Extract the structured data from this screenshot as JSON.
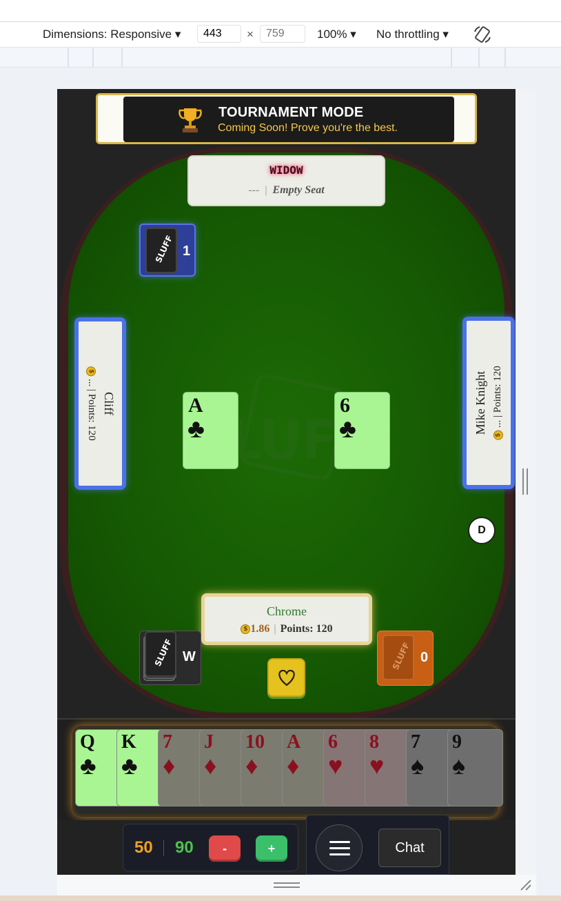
{
  "devtools": {
    "dimensions_label": "Dimensions: Responsive",
    "width": "443",
    "times": "×",
    "height_placeholder": "759",
    "zoom": "100%",
    "throttling": "No throttling"
  },
  "banner": {
    "title": "TOURNAMENT MODE",
    "subtitle": "Coming Soon! Prove you're the best."
  },
  "watermark": "LUF",
  "widow": {
    "name": "WIDOW",
    "dash": "---",
    "sep": "|",
    "status": "Empty Seat"
  },
  "players": {
    "left": {
      "name": "Cliff",
      "money": "...",
      "points": "Points: 120",
      "sep": "|"
    },
    "right": {
      "name": "Mike Knight",
      "money": "...",
      "points": "Points: 120",
      "sep": "|"
    },
    "me": {
      "name": "Chrome",
      "money": "1.86",
      "points": "Points: 120",
      "sep": "|"
    }
  },
  "counters": {
    "top_left": "1",
    "bottom_left": "W",
    "bottom_right": "0",
    "brand": "SLUFF"
  },
  "table_cards": [
    {
      "rank": "A",
      "suit": "♣"
    },
    {
      "rank": "6",
      "suit": "♣"
    }
  ],
  "dealer_button": "D",
  "hand": [
    {
      "rank": "Q",
      "suit": "♣",
      "color": "#111111",
      "bg": "#a9f593"
    },
    {
      "rank": "K",
      "suit": "♣",
      "color": "#111111",
      "bg": "#a9f593"
    },
    {
      "rank": "7",
      "suit": "♦",
      "color": "#8a1020",
      "bg": "#7b7b6f"
    },
    {
      "rank": "J",
      "suit": "♦",
      "color": "#8a1020",
      "bg": "#7b7b6f"
    },
    {
      "rank": "10",
      "suit": "♦",
      "color": "#8a1020",
      "bg": "#7b7b6f"
    },
    {
      "rank": "A",
      "suit": "♦",
      "color": "#8a1020",
      "bg": "#7b7b6f"
    },
    {
      "rank": "6",
      "suit": "♥",
      "color": "#8a1020",
      "bg": "#857575"
    },
    {
      "rank": "8",
      "suit": "♥",
      "color": "#8a1020",
      "bg": "#857575"
    },
    {
      "rank": "7",
      "suit": "♠",
      "color": "#111111",
      "bg": "#6e6e6e"
    },
    {
      "rank": "9",
      "suit": "♠",
      "color": "#111111",
      "bg": "#6e6e6e"
    }
  ],
  "controls": {
    "bid_low": "50",
    "bid_high": "90",
    "minus": "-",
    "plus": "+",
    "chat": "Chat"
  },
  "colors": {
    "felt": "#165a03",
    "seat_border": "#4a72e8",
    "gold": "#e6c21f"
  }
}
